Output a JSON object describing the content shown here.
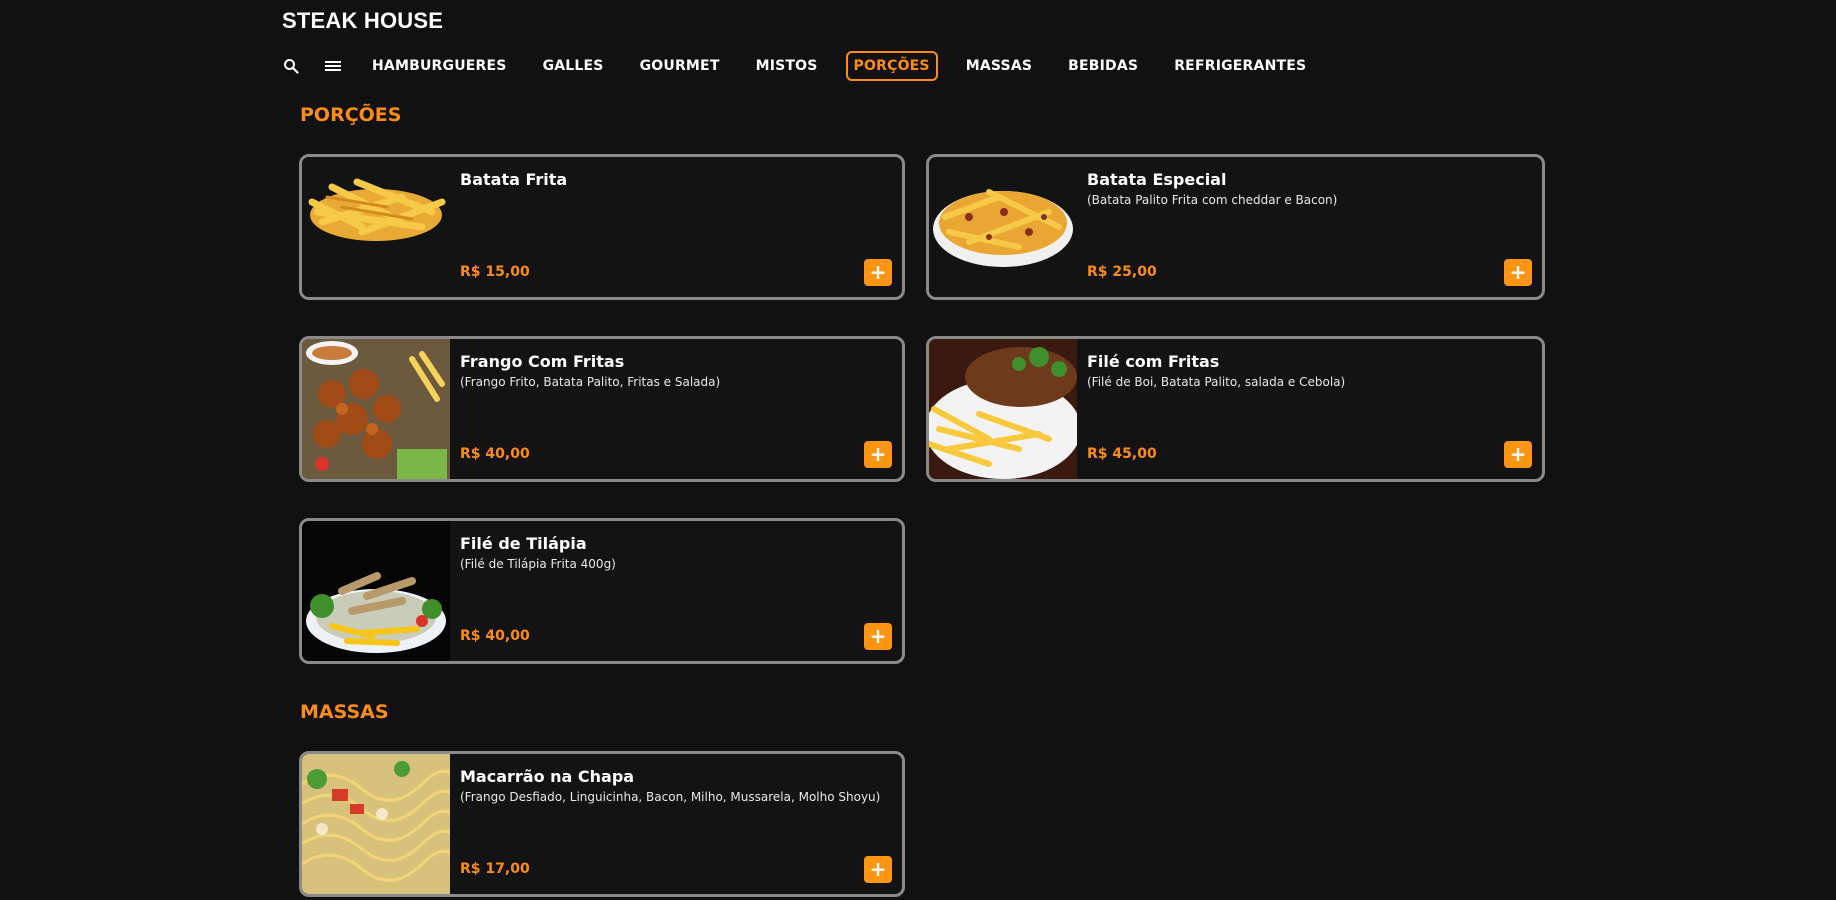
{
  "header": {
    "brand": "STEAK HOUSE"
  },
  "nav": {
    "search_icon": "search-icon",
    "menu_icon": "menu-icon",
    "tabs": [
      "HAMBURGUERES",
      "GALLES",
      "GOURMET",
      "MISTOS",
      "PORÇÕES",
      "MASSAS",
      "BEBIDAS",
      "REFRIGERANTES"
    ],
    "active_tab": "PORÇÕES"
  },
  "sections": {
    "porcoes": {
      "title": "PORÇÕES",
      "items": [
        {
          "name": "Batata Frita",
          "desc": "",
          "price": "R$ 15,00",
          "add_label": "+"
        },
        {
          "name": "Batata Especial",
          "desc": "(Batata Palito Frita com cheddar e Bacon)",
          "price": "R$ 25,00",
          "add_label": "+"
        },
        {
          "name": "Frango Com Fritas",
          "desc": "(Frango Frito, Batata Palito, Fritas e Salada)",
          "price": "R$ 40,00",
          "add_label": "+"
        },
        {
          "name": "Filé com Fritas",
          "desc": "(Filé de Boi, Batata Palito, salada e Cebola)",
          "price": "R$ 45,00",
          "add_label": "+"
        },
        {
          "name": "Filé de Tilápia",
          "desc": "(Filé de Tilápia Frita 400g)",
          "price": "R$ 40,00",
          "add_label": "+"
        }
      ]
    },
    "massas": {
      "title": "MASSAS",
      "items": [
        {
          "name": "Macarrão na Chapa",
          "desc": "(Frango Desfiado, Linguicinha, Bacon, Milho, Mussarela, Molho Shoyu)",
          "price": "R$ 17,00",
          "add_label": "+"
        }
      ]
    }
  },
  "colors": {
    "accent": "#ff8c1a",
    "background": "#111111",
    "card_border": "#8a8a8a",
    "add_button": "#ff9513"
  }
}
